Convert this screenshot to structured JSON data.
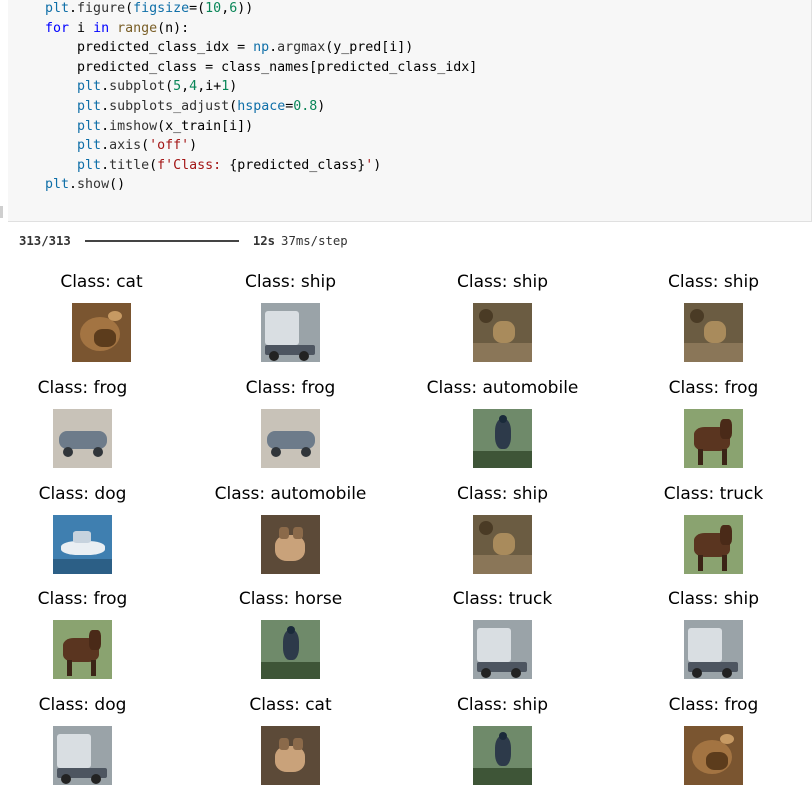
{
  "code_lines": [
    "plt.figure(figsize=(10,6))",
    "for i in range(n):",
    "    predicted_class_idx = np.argmax(y_pred[i])",
    "    predicted_class = class_names[predicted_class_idx]",
    "    plt.subplot(5,4,i+1)",
    "    plt.subplots_adjust(hspace=0.8)",
    "    plt.imshow(x_train[i])",
    "    plt.axis('off')",
    "    plt.title(f'Class: {predicted_class}')",
    "plt.show()"
  ],
  "progress": {
    "count": "313/313",
    "time": "12s",
    "step": "37ms/step",
    "fraction": 1.0
  },
  "grid_titles": [
    "Class: cat",
    "Class: ship",
    "Class: ship",
    "Class: ship",
    "Class: frog",
    "Class: frog",
    "Class: automobile",
    "Class: frog",
    "Class: dog",
    "Class: automobile",
    "Class: ship",
    "Class: truck",
    "Class: frog",
    "Class: horse",
    "Class: truck",
    "Class: ship",
    "Class: dog",
    "Class: cat",
    "Class: ship",
    "Class: frog"
  ],
  "thumb_content": [
    "frog-photo",
    "truck-photo",
    "deer-photo",
    "deer-photo",
    "automobile-photo",
    "automobile-photo",
    "bird-photo",
    "horse-photo",
    "ship-photo",
    "cat-photo",
    "deer-photo",
    "horse-photo",
    "horse-photo",
    "bird-photo",
    "truck-photo",
    "truck-photo",
    "truck-photo",
    "cat-photo",
    "bird-photo",
    "frog-photo"
  ]
}
